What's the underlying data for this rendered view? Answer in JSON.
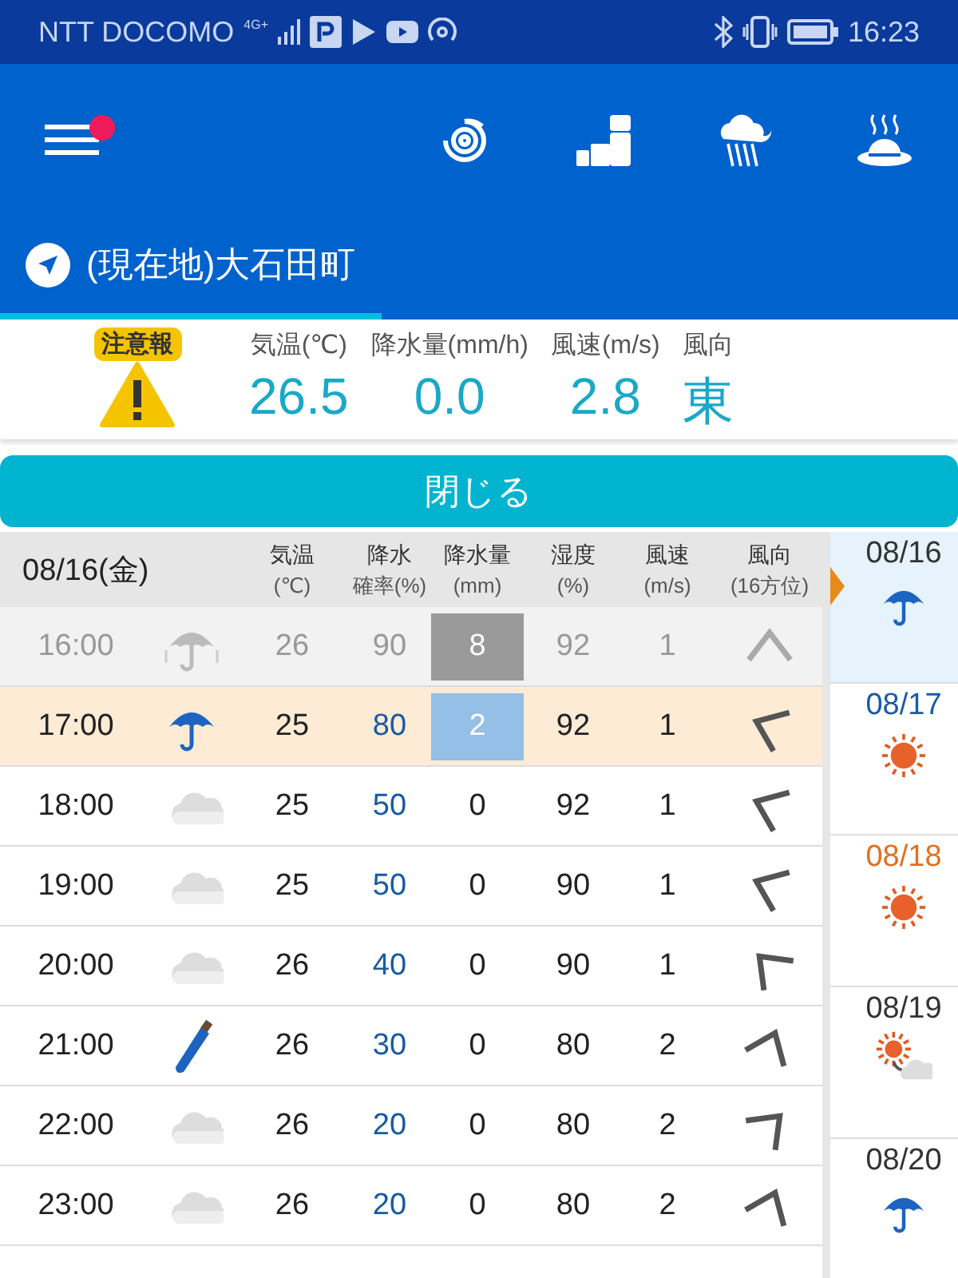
{
  "status_bar": {
    "carrier": "NTT DOCOMO",
    "network": "4G+",
    "time": "16:23"
  },
  "header": {
    "menu_badge": true
  },
  "location": {
    "name": "(現在地)大石田町",
    "selected": true
  },
  "alert": {
    "label": "注意報"
  },
  "now": [
    {
      "label": "気温(℃)",
      "value": "26.5"
    },
    {
      "label": "降水量(mm/h)",
      "value": "0.0"
    },
    {
      "label": "風速(m/s)",
      "value": "2.8"
    },
    {
      "label": "風向",
      "value": "東"
    }
  ],
  "close_button": "閉じる",
  "table": {
    "date": "08/16(金)",
    "columns": [
      {
        "line1": "気温",
        "line2": "(℃)"
      },
      {
        "line1": "降水",
        "line2": "確率(%)"
      },
      {
        "line1": "降水量",
        "line2": "(mm)"
      },
      {
        "line1": "湿度",
        "line2": "(%)"
      },
      {
        "line1": "風速",
        "line2": "(m/s)"
      },
      {
        "line1": "風向",
        "line2": "(16方位)"
      }
    ],
    "rows": [
      {
        "time": "16:00",
        "weather_icon": {
          "kind": "rain"
        },
        "temp": "26",
        "pop": "90",
        "rain": "8",
        "humidity": "92",
        "wind": "1",
        "wind_arrow": {
          "kind": "n"
        },
        "past": true,
        "selected": false,
        "rain_marked": true
      },
      {
        "time": "17:00",
        "weather_icon": {
          "kind": "rain"
        },
        "temp": "25",
        "pop": "80",
        "rain": "2",
        "humidity": "92",
        "wind": "1",
        "wind_arrow": {
          "kind": "wnw"
        },
        "past": false,
        "selected": true,
        "rain_marked": true
      },
      {
        "time": "18:00",
        "weather_icon": {
          "kind": "cloudy"
        },
        "temp": "25",
        "pop": "50",
        "rain": "0",
        "humidity": "92",
        "wind": "1",
        "wind_arrow": {
          "kind": "wnw"
        },
        "past": false,
        "selected": false,
        "rain_marked": false
      },
      {
        "time": "19:00",
        "weather_icon": {
          "kind": "cloudy"
        },
        "temp": "25",
        "pop": "50",
        "rain": "0",
        "humidity": "90",
        "wind": "1",
        "wind_arrow": {
          "kind": "wnw"
        },
        "past": false,
        "selected": false,
        "rain_marked": false
      },
      {
        "time": "20:00",
        "weather_icon": {
          "kind": "cloudy"
        },
        "temp": "26",
        "pop": "40",
        "rain": "0",
        "humidity": "90",
        "wind": "1",
        "wind_arrow": {
          "kind": "nw"
        },
        "past": false,
        "selected": false,
        "rain_marked": false
      },
      {
        "time": "21:00",
        "weather_icon": {
          "kind": "umbrella-closed"
        },
        "temp": "26",
        "pop": "30",
        "rain": "0",
        "humidity": "80",
        "wind": "2",
        "wind_arrow": {
          "kind": "nne"
        },
        "past": false,
        "selected": false,
        "rain_marked": false
      },
      {
        "time": "22:00",
        "weather_icon": {
          "kind": "cloudy"
        },
        "temp": "26",
        "pop": "20",
        "rain": "0",
        "humidity": "80",
        "wind": "2",
        "wind_arrow": {
          "kind": "ne"
        },
        "past": false,
        "selected": false,
        "rain_marked": false
      },
      {
        "time": "23:00",
        "weather_icon": {
          "kind": "cloudy"
        },
        "temp": "26",
        "pop": "20",
        "rain": "0",
        "humidity": "80",
        "wind": "2",
        "wind_arrow": {
          "kind": "nne"
        },
        "past": false,
        "selected": false,
        "rain_marked": false
      }
    ]
  },
  "days": [
    {
      "date": "08/16",
      "color": "#333333",
      "weather_icon": {
        "kind": "rain"
      },
      "selected": true
    },
    {
      "date": "08/17",
      "color": "#1a5aa8",
      "weather_icon": {
        "kind": "sunny"
      },
      "selected": false
    },
    {
      "date": "08/18",
      "color": "#e07020",
      "weather_icon": {
        "kind": "sunny"
      },
      "selected": false
    },
    {
      "date": "08/19",
      "color": "#333333",
      "weather_icon": {
        "kind": "sunny-then-cloudy"
      },
      "selected": false
    },
    {
      "date": "08/20",
      "color": "#333333",
      "weather_icon": {
        "kind": "rain"
      },
      "selected": false
    }
  ]
}
